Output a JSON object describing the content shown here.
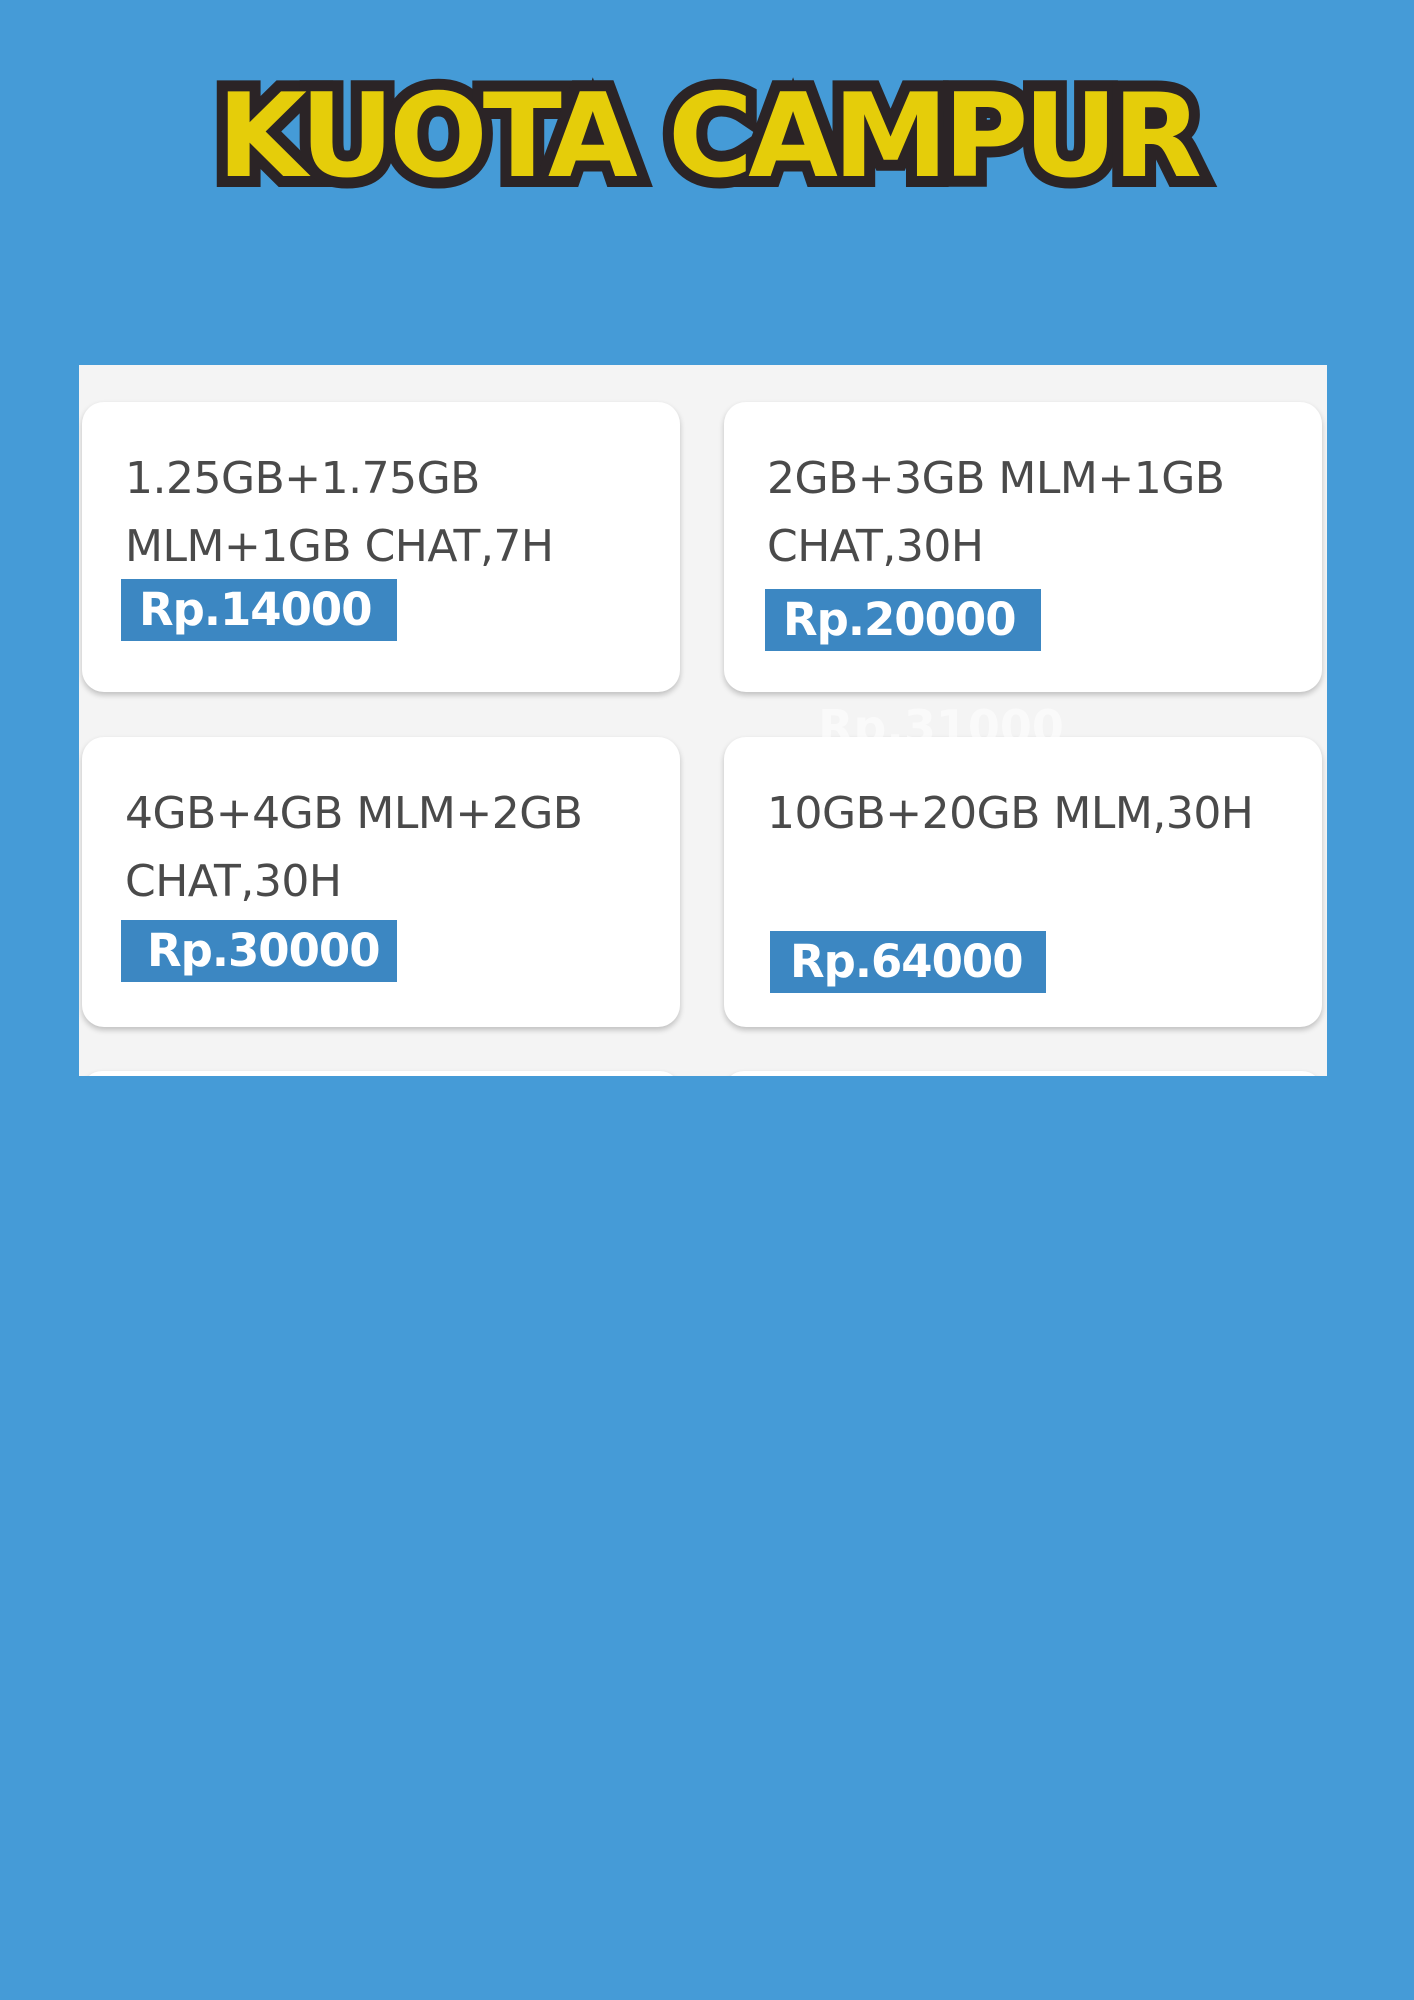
{
  "header": {
    "title": "KUOTA CAMPUR"
  },
  "packages": [
    {
      "name": "1.25GB+1.75GB MLM+1GB CHAT,7H",
      "price": "Rp.14000"
    },
    {
      "name": "2GB+3GB MLM+1GB CHAT,30H",
      "price": "Rp.20000"
    },
    {
      "name": "4GB+4GB MLM+2GB CHAT,30H",
      "price": "Rp.30000"
    },
    {
      "name": "10GB+20GB MLM,30H",
      "price": "Rp.64000"
    }
  ],
  "ghost_price": "Rp.31000",
  "colors": {
    "background": "#459bd7",
    "title_fill": "#e5cd0a",
    "title_outline": "#2b2426",
    "price_tag": "#3c87c2",
    "panel": "#f4f4f4"
  }
}
